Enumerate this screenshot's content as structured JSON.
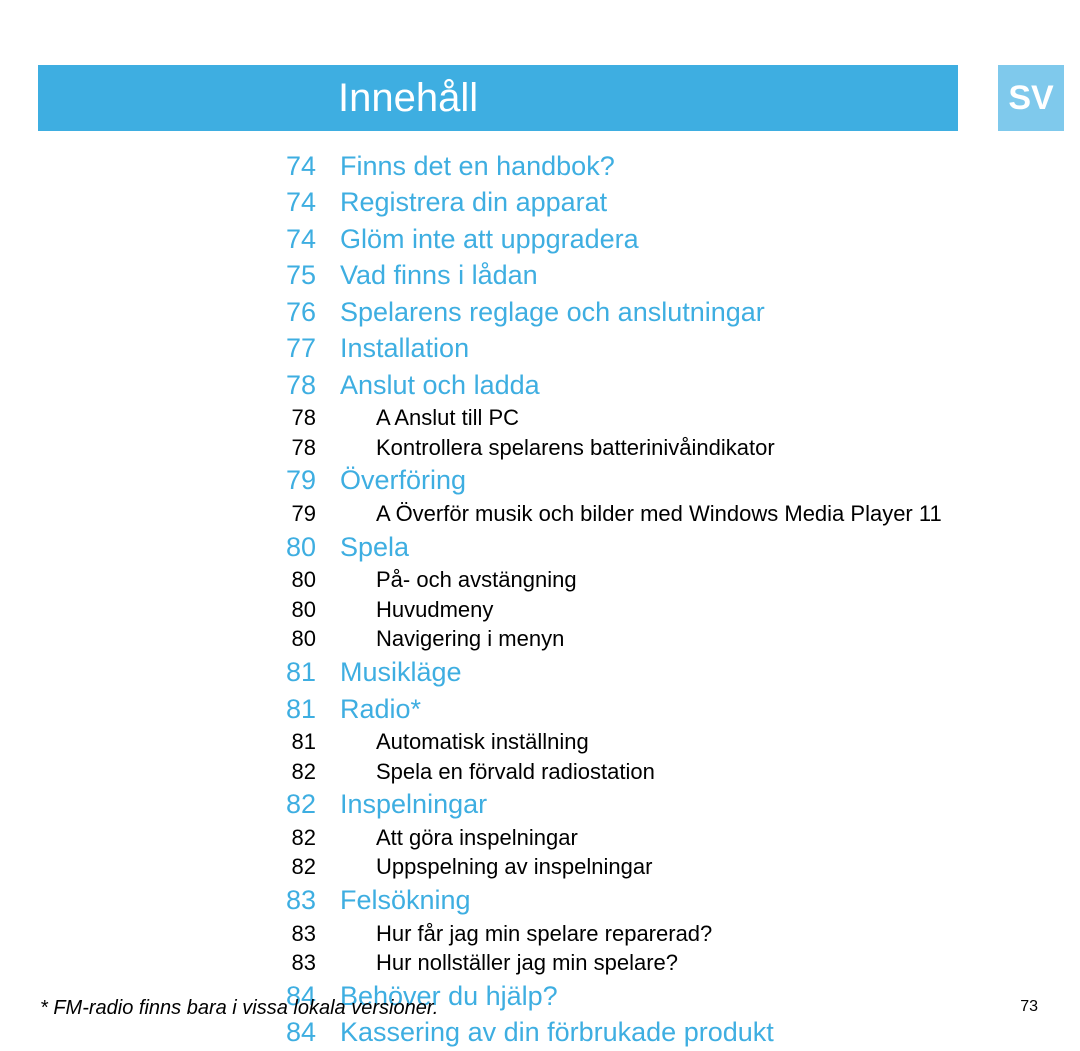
{
  "header": {
    "title": "Innehåll",
    "lang": "SV"
  },
  "toc": [
    {
      "type": "major",
      "page": "74",
      "label": "Finns det en handbok?"
    },
    {
      "type": "major",
      "page": "74",
      "label": "Registrera din apparat"
    },
    {
      "type": "major",
      "page": "74",
      "label": "Glöm inte att uppgradera"
    },
    {
      "type": "major",
      "page": "75",
      "label": "Vad finns i lådan"
    },
    {
      "type": "major",
      "page": "76",
      "label": "Spelarens reglage och anslutningar"
    },
    {
      "type": "major",
      "page": "77",
      "label": "Installation"
    },
    {
      "type": "major",
      "page": "78",
      "label": "Anslut och ladda"
    },
    {
      "type": "minor",
      "page": "78",
      "label": "A Anslut till PC"
    },
    {
      "type": "minor",
      "page": "78",
      "label": "Kontrollera spelarens batterinivåindikator"
    },
    {
      "type": "major",
      "page": "79",
      "label": "Överföring"
    },
    {
      "type": "minor",
      "page": "79",
      "label": "A Överför musik och bilder med Windows Media Player 11"
    },
    {
      "type": "major",
      "page": "80",
      "label": "Spela"
    },
    {
      "type": "minor",
      "page": "80",
      "label": "På- och avstängning"
    },
    {
      "type": "minor",
      "page": "80",
      "label": "Huvudmeny"
    },
    {
      "type": "minor",
      "page": "80",
      "label": "Navigering i menyn"
    },
    {
      "type": "major",
      "page": "81",
      "label": "Musikläge"
    },
    {
      "type": "major",
      "page": "81",
      "label": "Radio*"
    },
    {
      "type": "minor",
      "page": "81",
      "label": "Automatisk inställning"
    },
    {
      "type": "minor",
      "page": "82",
      "label": "Spela en förvald radiostation"
    },
    {
      "type": "major",
      "page": "82",
      "label": "Inspelningar"
    },
    {
      "type": "minor",
      "page": "82",
      "label": "Att göra inspelningar"
    },
    {
      "type": "minor",
      "page": "82",
      "label": "Uppspelning av inspelningar"
    },
    {
      "type": "major",
      "page": "83",
      "label": "Felsökning"
    },
    {
      "type": "minor",
      "page": "83",
      "label": "Hur får jag min spelare reparerad?"
    },
    {
      "type": "minor",
      "page": "83",
      "label": "Hur nollställer jag min spelare?"
    },
    {
      "type": "major",
      "page": "84",
      "label": "Behöver du hjälp?"
    },
    {
      "type": "major",
      "page": "84",
      "label": "Kassering av din förbrukade produkt"
    }
  ],
  "footnote": "*  FM-radio finns bara i vissa lokala versioner.",
  "page_number": "73"
}
